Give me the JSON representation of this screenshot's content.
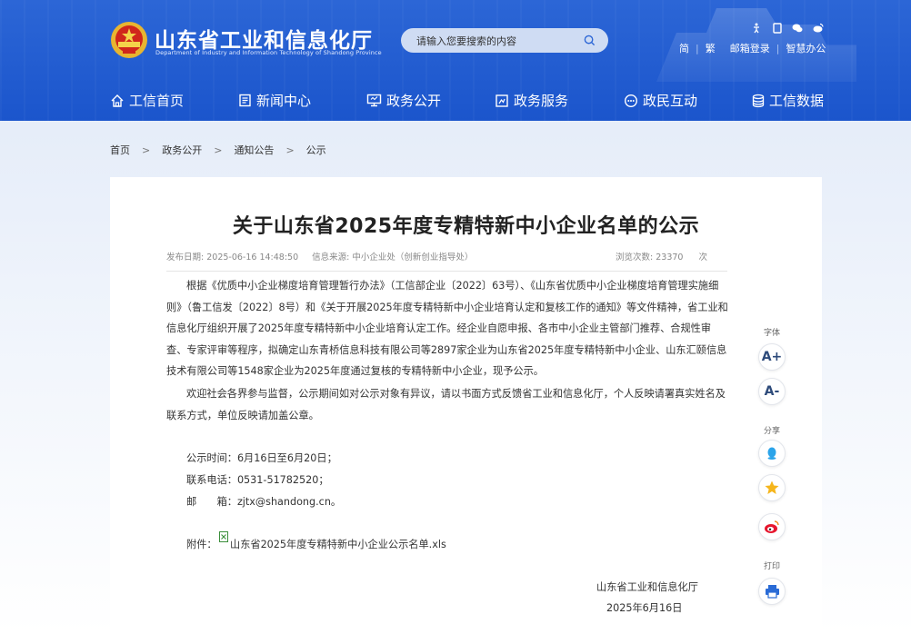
{
  "header": {
    "site_title": "山东省工业和信息化厅",
    "site_subtitle": "Department of Industry and Information Technology of Shandong Province",
    "search_placeholder": "请输入您要搜索的内容",
    "top_links": {
      "simplified": "简",
      "traditional": "繁",
      "mail_login": "邮箱登录",
      "smart_office": "智慧办公"
    },
    "top_icons": [
      "accessibility-icon",
      "mobile-icon",
      "wechat-icon",
      "weibo-icon"
    ]
  },
  "nav": [
    {
      "label": "工信首页",
      "icon": "home-icon"
    },
    {
      "label": "新闻中心",
      "icon": "news-icon"
    },
    {
      "label": "政务公开",
      "icon": "monitor-icon"
    },
    {
      "label": "政务服务",
      "icon": "service-icon"
    },
    {
      "label": "政民互动",
      "icon": "interaction-icon"
    },
    {
      "label": "工信数据",
      "icon": "database-icon"
    }
  ],
  "breadcrumb": {
    "items": [
      "首页",
      "政务公开",
      "通知公告",
      "公示"
    ],
    "separator": ">"
  },
  "article": {
    "title": "关于山东省2025年度专精特新中小企业名单的公示",
    "publish_date_label": "发布日期:",
    "publish_date": "2025-06-16 14:48:50",
    "source_label": "信息来源:",
    "source": "中小企业处（创新创业指导处）",
    "views_label": "浏览次数:",
    "views": "23370",
    "views_unit": "次",
    "para1": "根据《优质中小企业梯度培育管理暂行办法》（工信部企业〔2022〕63号）、《山东省优质中小企业梯度培育管理实施细则》（鲁工信发〔2022〕8号）和《关于开展2025年度专精特新中小企业培育认定和复核工作的通知》等文件精神，省工业和信息化厅组织开展了2025年度专精特新中小企业培育认定工作。经企业自愿申报、各市中小企业主管部门推荐、合规性审查、专家评审等程序，拟确定山东青桥信息科技有限公司等2897家企业为山东省2025年度专精特新中小企业、山东汇颐信息技术有限公司等1548家企业为2025年度通过复核的专精特新中小企业，现予公示。",
    "para2": "欢迎社会各界参与监督，公示期间如对公示对象有异议，请以书面方式反馈省工业和信息化厅，个人反映请署真实姓名及联系方式，单位反映请加盖公章。",
    "period": "公示时间：6月16日至6月20日；",
    "phone": "联系电话：0531-51782520；",
    "email": "邮　　箱：zjtx@shandong.cn。",
    "attachment_label": "附件：",
    "attachment_name": "山东省2025年度专精特新中小企业公示名单.xls",
    "sign_org": "山东省工业和信息化厅",
    "sign_date": "2025年6月16日"
  },
  "side_tools": {
    "font_label": "字体",
    "font_increase": "A+",
    "font_decrease": "A-",
    "share_label": "分享",
    "print_label": "打印"
  },
  "colors": {
    "header_blue": "#1b55cc",
    "text": "#333333"
  }
}
